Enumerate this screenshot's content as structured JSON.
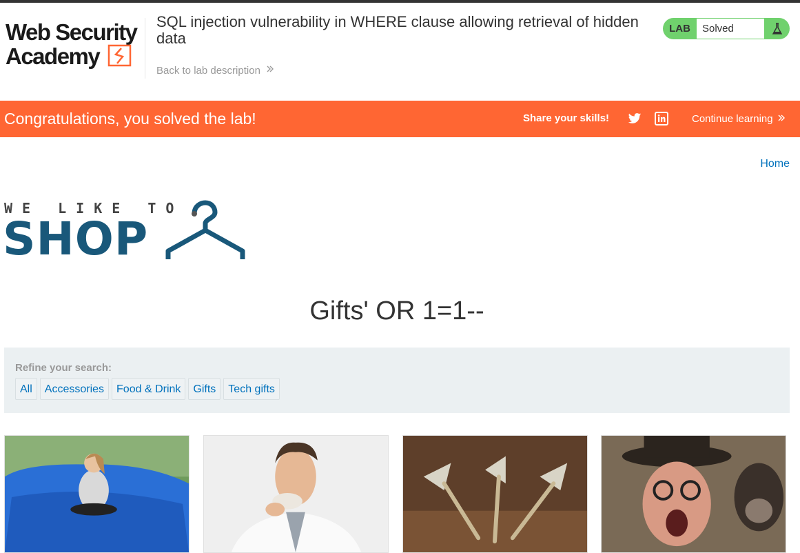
{
  "header": {
    "logo_text": "Web Security Academy",
    "lab_title": "SQL injection vulnerability in WHERE clause allowing retrieval of hidden data",
    "back_link": "Back to lab description",
    "lab_label": "LAB",
    "lab_status": "Solved",
    "icons": {
      "back": "chevron-double-right-icon",
      "flask": "flask-icon"
    }
  },
  "banner": {
    "message": "Congratulations, you solved the lab!",
    "share_label": "Share your skills!",
    "continue_label": "Continue learning",
    "icons": {
      "twitter": "twitter-icon",
      "linkedin": "linkedin-icon",
      "continue": "chevron-double-right-icon"
    }
  },
  "nav": {
    "home": "Home"
  },
  "shop_logo": {
    "line1": "WE LIKE TO",
    "line2": "SHOP"
  },
  "category_heading": "Gifts' OR 1=1--",
  "filter": {
    "label": "Refine your search:",
    "categories": [
      "All",
      "Accessories",
      "Food & Drink",
      "Gifts",
      "Tech gifts"
    ]
  },
  "products": [
    {
      "image": "girl-on-blue-beanbag"
    },
    {
      "image": "man-eating-cookie"
    },
    {
      "image": "darts"
    },
    {
      "image": "old-man-and-monkey"
    }
  ],
  "colors": {
    "banner": "#ff6633",
    "solved": "#70d16d",
    "link": "#0071bc",
    "shop_blue": "#19587a",
    "filter_bg": "#ebf0f2"
  }
}
